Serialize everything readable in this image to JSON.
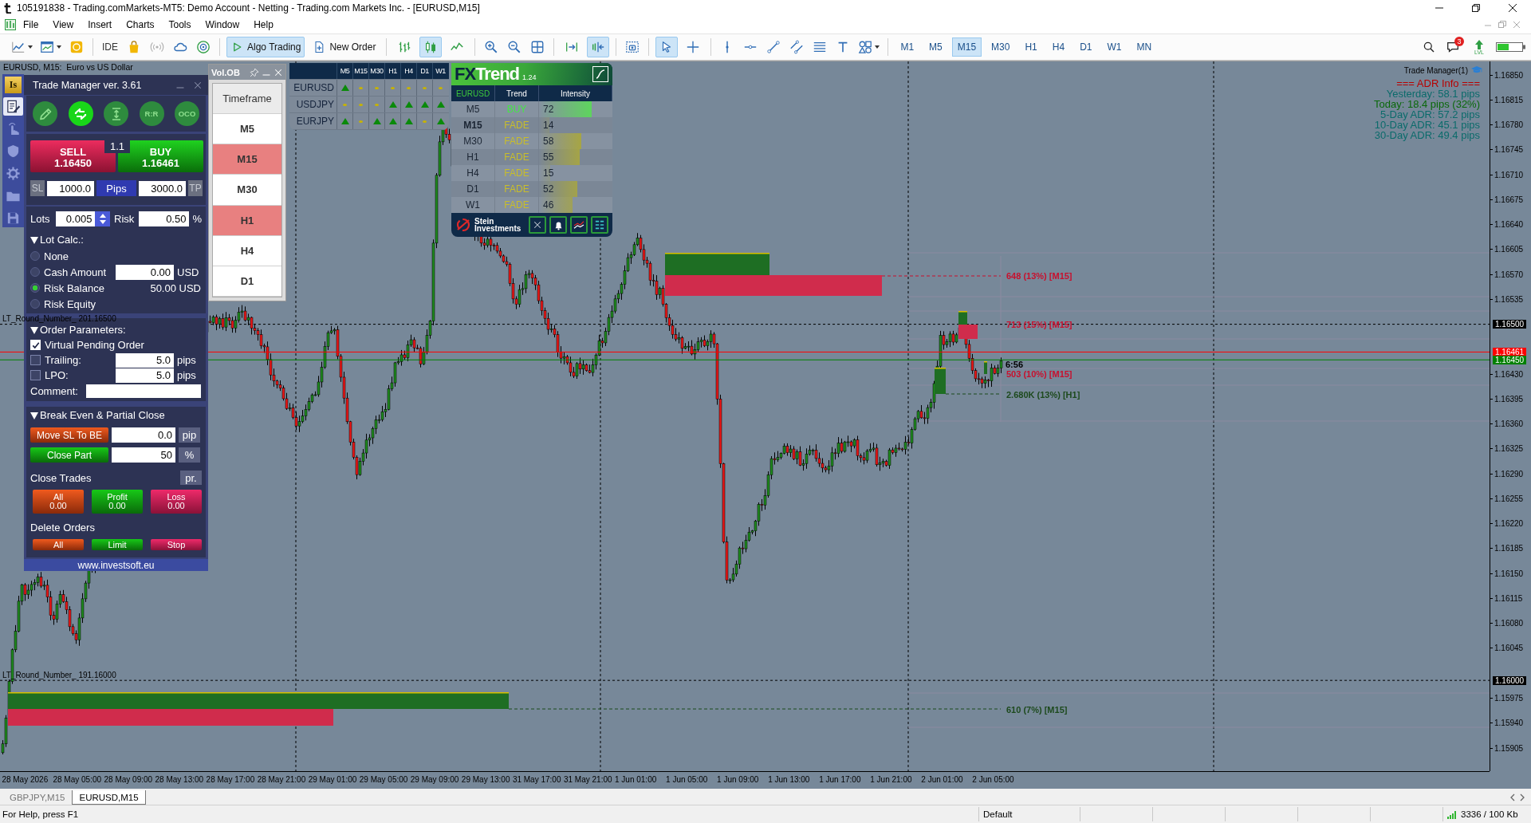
{
  "window": {
    "title": "105191838 - Trading.comMarkets-MT5: Demo Account - Netting - Trading.com Markets Inc. - [EURUSD,M15]"
  },
  "menu": [
    "File",
    "View",
    "Insert",
    "Charts",
    "Tools",
    "Window",
    "Help"
  ],
  "toolbar": {
    "ide": "IDE",
    "algo_trading": {
      "label": "Algo Trading",
      "on": true
    },
    "new_order": "New Order",
    "chart_types": [
      {
        "selected": false
      },
      {
        "selected": true
      },
      {
        "selected": false
      }
    ],
    "auto_scroll": {
      "on": false
    },
    "chart_shift": {
      "on": true
    },
    "pointer_modes": [
      {
        "selected": true
      },
      {
        "selected": false
      }
    ],
    "timeframes": [
      {
        "label": "M1",
        "selected": false
      },
      {
        "label": "M5",
        "selected": false
      },
      {
        "label": "M15",
        "selected": true
      },
      {
        "label": "M30",
        "selected": false
      },
      {
        "label": "H1",
        "selected": false
      },
      {
        "label": "H4",
        "selected": false
      },
      {
        "label": "D1",
        "selected": false
      },
      {
        "label": "W1",
        "selected": false
      },
      {
        "label": "MN",
        "selected": false
      }
    ],
    "messages_badge": "3",
    "level_label": "LVL"
  },
  "chart": {
    "header": "EURUSD, M15:  Euro vs US Dollar",
    "indicator_label": "Trade Manager(1)",
    "adr_info": [
      {
        "text": "=== ADR Info ===",
        "color": "#b80000"
      },
      {
        "text": "Yesterday: 58.1 pips",
        "color": "#0b6b6b"
      },
      {
        "text": "Today: 18.4 pips (32%)",
        "color": "#0a680a"
      },
      {
        "text": "5-Day ADR: 57.2 pips",
        "color": "#0b6b6b"
      },
      {
        "text": "10-Day ADR: 45.1 pips",
        "color": "#0b6b6b"
      },
      {
        "text": "30-Day ADR: 49.4 pips",
        "color": "#0b6b6b"
      }
    ],
    "round_numbers": [
      {
        "label": "LT_Round_Number_ 201.16500",
        "price": "1.16500"
      },
      {
        "label": "LT_Round_Number_ 191.16000",
        "price": "1.16000"
      }
    ],
    "ask": "1.16461",
    "bid": "1.16450",
    "price_ticks": [
      "1.16850",
      "1.16815",
      "1.16780",
      "1.16745",
      "1.16710",
      "1.16675",
      "1.16640",
      "1.16605",
      "1.16570",
      "1.16535",
      "1.16430",
      "1.16395",
      "1.16360",
      "1.16325",
      "1.16290",
      "1.16255",
      "1.16220",
      "1.16185",
      "1.16150",
      "1.16115",
      "1.16080",
      "1.16045",
      "1.15975",
      "1.15940",
      "1.15905"
    ],
    "time_labels": [
      "28 May 2026",
      "28 May 05:00",
      "28 May 09:00",
      "28 May 13:00",
      "28 May 17:00",
      "28 May 21:00",
      "29 May 01:00",
      "29 May 05:00",
      "29 May 09:00",
      "29 May 13:00",
      "31 May 17:00",
      "31 May 21:00",
      "1 Jun 01:00",
      "1 Jun 05:00",
      "1 Jun 09:00",
      "1 Jun 13:00",
      "1 Jun 17:00",
      "1 Jun 21:00",
      "2 Jun 01:00",
      "2 Jun 05:00"
    ],
    "candle_timer": "6:56",
    "order_blocks": [
      {
        "label": "648 (13%) [M15]",
        "kind": "supply"
      },
      {
        "label": "713 (15%) [M15]",
        "kind": "supply"
      },
      {
        "label": "503 (10%) [M15]",
        "kind": "supply"
      },
      {
        "label": "2.680K (13%) [H1]",
        "kind": "demand"
      },
      {
        "label": "610 (7%) [M15]",
        "kind": "demand"
      }
    ]
  },
  "trade_manager": {
    "logo": "Is",
    "side_tools": [
      {
        "selected": true
      },
      {
        "selected": false
      },
      {
        "selected": false
      },
      {
        "selected": false
      },
      {
        "selected": false
      },
      {
        "selected": false
      }
    ],
    "title": "Trade Manager ver. 3.61",
    "modes": [
      {
        "active": false
      },
      {
        "active": true
      },
      {
        "active": false
      },
      {
        "label": "R:R",
        "active": false
      },
      {
        "label": "OCO",
        "active": false
      }
    ],
    "sell": {
      "label": "SELL",
      "price": "1.16450"
    },
    "buy": {
      "label": "BUY",
      "price": "1.16461"
    },
    "spread": "1.1",
    "sl": {
      "label": "SL",
      "value": "1000.0"
    },
    "units": "Pips",
    "tp": {
      "label": "TP",
      "value": "3000.0"
    },
    "lots": {
      "label": "Lots",
      "value": "0.005"
    },
    "risk": {
      "label": "Risk",
      "value": "0.50",
      "unit": "%"
    },
    "lot_calc": {
      "title": "Lot Calc.:",
      "expanded": true,
      "options": [
        {
          "label": "None",
          "selected": false
        },
        {
          "label": "Cash Amount",
          "selected": false,
          "value": "0.00",
          "unit": "USD"
        },
        {
          "label": "Risk Balance",
          "selected": true,
          "reading": "50.00 USD"
        },
        {
          "label": "Risk Equity",
          "selected": false
        }
      ]
    },
    "order_params": {
      "title": "Order Parameters:",
      "expanded": true,
      "options": [
        {
          "label": "Virtual Pending Order",
          "checked": true
        },
        {
          "label": "Trailing:",
          "checked": false,
          "value": "5.0",
          "unit": "pips"
        },
        {
          "label": "LPO:",
          "checked": false,
          "value": "5.0",
          "unit": "pips"
        }
      ],
      "comment": {
        "label": "Comment:"
      }
    },
    "break_even": {
      "title": "Break Even & Partial Close",
      "expanded": true,
      "rows": [
        {
          "button": "Move SL To BE",
          "kind": "move",
          "value": "0.0",
          "unit": "pip"
        },
        {
          "button": "Close Part",
          "kind": "partial",
          "value": "50",
          "unit": "%"
        }
      ]
    },
    "close_trades": {
      "title": "Close Trades",
      "mode_button": "pr.",
      "buttons": [
        {
          "label": "All",
          "value": "0.00",
          "kind": "all"
        },
        {
          "label": "Profit",
          "value": "0.00",
          "kind": "profit"
        },
        {
          "label": "Loss",
          "value": "0.00",
          "kind": "loss"
        }
      ]
    },
    "delete_orders": {
      "title": "Delete Orders",
      "buttons": [
        {
          "label": "All",
          "kind": "all"
        },
        {
          "label": "Limit",
          "kind": "limit"
        },
        {
          "label": "Stop",
          "kind": "stop"
        }
      ]
    },
    "website": "www.investsoft.eu"
  },
  "volume_ob": {
    "title": "Vol.OB",
    "header": "Timeframe",
    "rows": [
      {
        "label": "M5",
        "active": false
      },
      {
        "label": "M15",
        "active": true
      },
      {
        "label": "M30",
        "active": false
      },
      {
        "label": "H1",
        "active": true
      },
      {
        "label": "H4",
        "active": false
      },
      {
        "label": "D1",
        "active": false
      }
    ]
  },
  "trend_matrix": {
    "columns": [
      "M5",
      "M15",
      "M30",
      "H1",
      "H4",
      "D1",
      "W1"
    ],
    "rows": [
      {
        "symbol": "EURUSD",
        "cells": [
          {
            "up": true
          },
          {
            "up": false
          },
          {
            "up": false
          },
          {
            "up": false
          },
          {
            "up": false
          },
          {
            "up": false
          },
          {
            "up": false
          }
        ]
      },
      {
        "symbol": "USDJPY",
        "cells": [
          {
            "up": false
          },
          {
            "up": false
          },
          {
            "up": false
          },
          {
            "up": true
          },
          {
            "up": true
          },
          {
            "up": true
          },
          {
            "up": true
          }
        ]
      },
      {
        "symbol": "EURJPY",
        "cells": [
          {
            "up": true
          },
          {
            "up": false
          },
          {
            "up": true
          },
          {
            "up": true
          },
          {
            "up": true
          },
          {
            "up": false
          },
          {
            "up": true
          }
        ]
      }
    ]
  },
  "fxtrend": {
    "logo_lead": "FX",
    "logo_rest": "Trend",
    "version": "1.24",
    "columns": [
      "EURUSD",
      "Trend",
      "Intensity"
    ],
    "rows": [
      {
        "timeframe": "M5",
        "trend": "BUY",
        "kind": "buy",
        "intensity": "72",
        "level": 0.72,
        "current": false
      },
      {
        "timeframe": "M15",
        "trend": "FADE",
        "kind": "fade",
        "intensity": "14",
        "level": 0.14,
        "current": true
      },
      {
        "timeframe": "M30",
        "trend": "FADE",
        "kind": "fade",
        "intensity": "58",
        "level": 0.58,
        "current": false
      },
      {
        "timeframe": "H1",
        "trend": "FADE",
        "kind": "fade",
        "intensity": "55",
        "level": 0.55,
        "current": false
      },
      {
        "timeframe": "H4",
        "trend": "FADE",
        "kind": "fade",
        "intensity": "15",
        "level": 0.15,
        "current": false
      },
      {
        "timeframe": "D1",
        "trend": "FADE",
        "kind": "fade",
        "intensity": "52",
        "level": 0.52,
        "current": false
      },
      {
        "timeframe": "W1",
        "trend": "FADE",
        "kind": "fade",
        "intensity": "46",
        "level": 0.46,
        "current": false
      }
    ],
    "brand": "Stein Investments"
  },
  "chart_tabs": [
    {
      "label": "GBPJPY,M15",
      "selected": false
    },
    {
      "label": "EURUSD,M15",
      "selected": true
    }
  ],
  "status_bar": {
    "help": "For Help, press F1",
    "profile": "Default",
    "traffic": "3336 / 100 Kb"
  }
}
